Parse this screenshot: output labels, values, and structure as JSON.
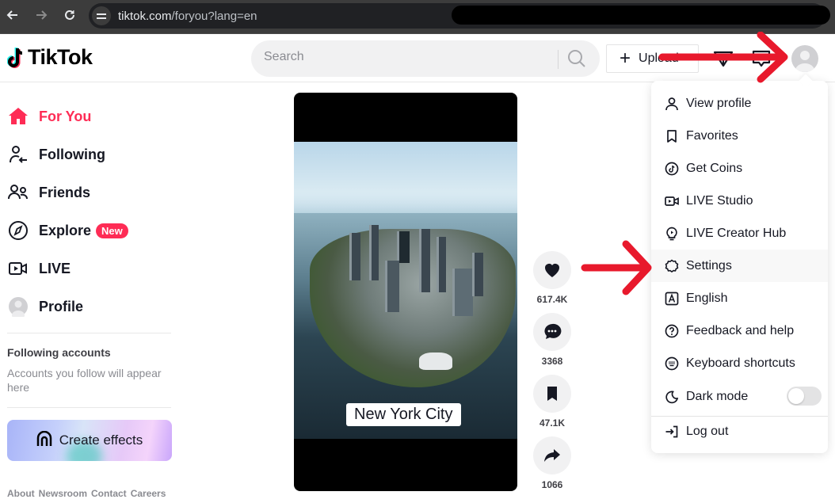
{
  "browser": {
    "url_host": "tiktok.com",
    "url_path": "/foryou?lang=en",
    "back_icon": "arrow-left-icon",
    "forward_icon": "arrow-right-icon",
    "reload_icon": "reload-icon"
  },
  "header": {
    "logo_text": "TikTok",
    "search_placeholder": "Search",
    "upload_label": "Upload",
    "brand_color": "#fe2c55"
  },
  "sidebar": {
    "items": [
      {
        "label": "For You",
        "icon": "home-icon",
        "active": true
      },
      {
        "label": "Following",
        "icon": "following-icon"
      },
      {
        "label": "Friends",
        "icon": "friends-icon"
      },
      {
        "label": "Explore",
        "icon": "compass-icon",
        "badge": "New"
      },
      {
        "label": "LIVE",
        "icon": "live-camera-icon"
      },
      {
        "label": "Profile",
        "icon": "avatar-icon"
      }
    ],
    "following_title": "Following accounts",
    "following_desc": "Accounts you follow will appear here",
    "create_effects": "Create effects",
    "footer_links": [
      "About",
      "Newsroom",
      "Contact",
      "Careers"
    ]
  },
  "video": {
    "caption": "New York City",
    "actions": [
      {
        "icon": "heart-icon",
        "count": "617.4K"
      },
      {
        "icon": "comment-icon",
        "count": "3368"
      },
      {
        "icon": "bookmark-icon",
        "count": "47.1K"
      },
      {
        "icon": "share-icon",
        "count": "1066"
      }
    ]
  },
  "menu": {
    "items": [
      {
        "label": "View profile",
        "icon": "user-icon"
      },
      {
        "label": "Favorites",
        "icon": "bookmark-outline-icon"
      },
      {
        "label": "Get Coins",
        "icon": "coin-icon"
      },
      {
        "label": "LIVE Studio",
        "icon": "live-studio-icon"
      },
      {
        "label": "LIVE Creator Hub",
        "icon": "lightbulb-icon"
      },
      {
        "label": "Settings",
        "icon": "gear-icon",
        "hovered": true
      },
      {
        "label": "English",
        "icon": "language-icon"
      },
      {
        "label": "Feedback and help",
        "icon": "help-icon"
      },
      {
        "label": "Keyboard shortcuts",
        "icon": "keyboard-icon"
      },
      {
        "label": "Dark mode",
        "icon": "moon-icon",
        "toggle": false
      },
      {
        "label": "Log out",
        "icon": "logout-icon"
      }
    ]
  },
  "annotations": {
    "arrow_color": "#e8192c"
  }
}
